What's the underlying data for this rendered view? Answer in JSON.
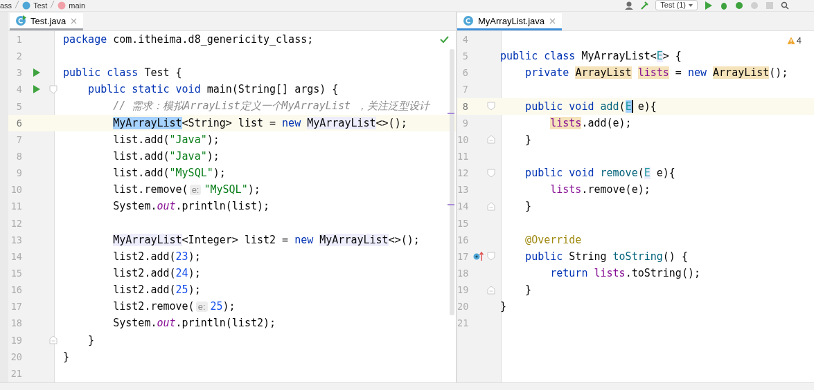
{
  "breadcrumbs": [
    {
      "label": "ass",
      "kind": "text"
    },
    {
      "label": "Test",
      "kind": "class"
    },
    {
      "label": "main",
      "kind": "method"
    }
  ],
  "toolbar": {
    "run_config": "Test (1)"
  },
  "panes": [
    {
      "active": false,
      "tab": {
        "label": "Test.java",
        "selected": true,
        "runnable": true
      },
      "no_problems": true,
      "lines": [
        {
          "n": "1",
          "tokens": [
            {
              "t": "package ",
              "kind": "kw"
            },
            {
              "t": "com.itheima.d8_genericity_class;",
              "kind": "plain"
            }
          ]
        },
        {
          "n": "2"
        },
        {
          "n": "3",
          "run": true,
          "tokens": [
            {
              "t": "public class ",
              "kind": "kw"
            },
            {
              "t": "Test {",
              "kind": "plain"
            }
          ]
        },
        {
          "n": "4",
          "run": true,
          "fold_start": true,
          "tokens": [
            {
              "t": "    public static void ",
              "kind": "kw"
            },
            {
              "t": "main(String[] args) {",
              "kind": "plain"
            }
          ]
        },
        {
          "n": "5",
          "tokens": [
            {
              "t": "        // 需求：模拟ArrayList定义一个MyArrayList ，关注泛型设计",
              "kind": "cmt"
            }
          ]
        },
        {
          "n": "6",
          "current": true,
          "tokens": [
            {
              "t": "        MyArrayList",
              "kind": "plain",
              "selected": true
            },
            {
              "t": "<String> list = ",
              "kind": "plain"
            },
            {
              "t": "new ",
              "kind": "kw"
            },
            {
              "t": "MyArrayList",
              "kind": "plain",
              "usage": true
            },
            {
              "t": "<>();",
              "kind": "plain"
            }
          ]
        },
        {
          "n": "7",
          "tokens": [
            {
              "t": "        list.add(",
              "kind": "plain"
            },
            {
              "t": "\"Java\"",
              "kind": "str"
            },
            {
              "t": ");",
              "kind": "plain"
            }
          ]
        },
        {
          "n": "8",
          "tokens": [
            {
              "t": "        list.add(",
              "kind": "plain"
            },
            {
              "t": "\"Java\"",
              "kind": "str"
            },
            {
              "t": ");",
              "kind": "plain"
            }
          ]
        },
        {
          "n": "9",
          "tokens": [
            {
              "t": "        list.add(",
              "kind": "plain"
            },
            {
              "t": "\"MySQL\"",
              "kind": "str"
            },
            {
              "t": ");",
              "kind": "plain"
            }
          ]
        },
        {
          "n": "10",
          "tokens": [
            {
              "t": "        list.remove(",
              "kind": "plain"
            },
            {
              "t": "e:",
              "kind": "hint"
            },
            {
              "t": "\"MySQL\"",
              "kind": "str"
            },
            {
              "t": ");",
              "kind": "plain"
            }
          ]
        },
        {
          "n": "11",
          "tokens": [
            {
              "t": "        System.",
              "kind": "plain"
            },
            {
              "t": "out",
              "kind": "static"
            },
            {
              "t": ".println(list);",
              "kind": "plain"
            }
          ]
        },
        {
          "n": "12"
        },
        {
          "n": "13",
          "tokens": [
            {
              "t": "        MyArrayList",
              "kind": "plain",
              "usage": true
            },
            {
              "t": "<Integer> list2 = ",
              "kind": "plain"
            },
            {
              "t": "new ",
              "kind": "kw"
            },
            {
              "t": "MyArrayList",
              "kind": "plain",
              "usage": true
            },
            {
              "t": "<>();",
              "kind": "plain"
            }
          ]
        },
        {
          "n": "14",
          "tokens": [
            {
              "t": "        list2.add(",
              "kind": "plain"
            },
            {
              "t": "23",
              "kind": "num"
            },
            {
              "t": ");",
              "kind": "plain"
            }
          ]
        },
        {
          "n": "15",
          "tokens": [
            {
              "t": "        list2.add(",
              "kind": "plain"
            },
            {
              "t": "24",
              "kind": "num"
            },
            {
              "t": ");",
              "kind": "plain"
            }
          ]
        },
        {
          "n": "16",
          "tokens": [
            {
              "t": "        list2.add(",
              "kind": "plain"
            },
            {
              "t": "25",
              "kind": "num"
            },
            {
              "t": ");",
              "kind": "plain"
            }
          ]
        },
        {
          "n": "17",
          "tokens": [
            {
              "t": "        list2.remove(",
              "kind": "plain"
            },
            {
              "t": "e:",
              "kind": "hint"
            },
            {
              "t": "25",
              "kind": "num"
            },
            {
              "t": ");",
              "kind": "plain"
            }
          ]
        },
        {
          "n": "18",
          "tokens": [
            {
              "t": "        System.",
              "kind": "plain"
            },
            {
              "t": "out",
              "kind": "static"
            },
            {
              "t": ".println(list2);",
              "kind": "plain"
            }
          ]
        },
        {
          "n": "19",
          "fold_end": true,
          "tokens": [
            {
              "t": "    }",
              "kind": "plain"
            }
          ]
        },
        {
          "n": "20",
          "tokens": [
            {
              "t": "}",
              "kind": "plain"
            }
          ]
        },
        {
          "n": "21"
        }
      ]
    },
    {
      "active": true,
      "tab": {
        "label": "MyArrayList.java",
        "selected": true,
        "runnable": false
      },
      "warnings": "4",
      "lines": [
        {
          "n": "4"
        },
        {
          "n": "5",
          "tokens": [
            {
              "t": "public class ",
              "kind": "kw"
            },
            {
              "t": "MyArrayList<",
              "kind": "plain"
            },
            {
              "t": "E",
              "kind": "tparam",
              "usage": true
            },
            {
              "t": "> {",
              "kind": "plain"
            }
          ]
        },
        {
          "n": "6",
          "tokens": [
            {
              "t": "    private ",
              "kind": "kw"
            },
            {
              "t": "ArrayList",
              "kind": "plain",
              "write": true
            },
            {
              "t": " lists",
              "kind": "field",
              "write": true
            },
            {
              "t": " = ",
              "kind": "plain"
            },
            {
              "t": "new ",
              "kind": "kw"
            },
            {
              "t": "ArrayList",
              "kind": "plain",
              "write": true
            },
            {
              "t": "();",
              "kind": "plain"
            }
          ]
        },
        {
          "n": "7"
        },
        {
          "n": "8",
          "current": true,
          "fold_start": true,
          "tokens": [
            {
              "t": "    public void ",
              "kind": "kw"
            },
            {
              "t": "add",
              "kind": "decl"
            },
            {
              "t": "(",
              "kind": "plain"
            },
            {
              "t": "E",
              "kind": "tparam",
              "selected": true,
              "caret": true
            },
            {
              "t": " e){",
              "kind": "plain"
            }
          ]
        },
        {
          "n": "9",
          "tokens": [
            {
              "t": "        lists",
              "kind": "field",
              "write": true
            },
            {
              "t": ".add(e);",
              "kind": "plain"
            }
          ]
        },
        {
          "n": "10",
          "fold_end": true,
          "tokens": [
            {
              "t": "    }",
              "kind": "plain"
            }
          ]
        },
        {
          "n": "11"
        },
        {
          "n": "12",
          "fold_start": true,
          "tokens": [
            {
              "t": "    public void ",
              "kind": "kw"
            },
            {
              "t": "remove",
              "kind": "decl"
            },
            {
              "t": "(",
              "kind": "plain"
            },
            {
              "t": "E",
              "kind": "tparam",
              "usage": true
            },
            {
              "t": " e){",
              "kind": "plain"
            }
          ]
        },
        {
          "n": "13",
          "tokens": [
            {
              "t": "        lists",
              "kind": "field"
            },
            {
              "t": ".remove(e);",
              "kind": "plain"
            }
          ]
        },
        {
          "n": "14",
          "fold_end": true,
          "tokens": [
            {
              "t": "    }",
              "kind": "plain"
            }
          ]
        },
        {
          "n": "15"
        },
        {
          "n": "16",
          "tokens": [
            {
              "t": "    @Override",
              "kind": "ann"
            }
          ]
        },
        {
          "n": "17",
          "override": true,
          "fold_start": true,
          "tokens": [
            {
              "t": "    public ",
              "kind": "kw"
            },
            {
              "t": "String ",
              "kind": "plain"
            },
            {
              "t": "toString",
              "kind": "decl"
            },
            {
              "t": "() {",
              "kind": "plain"
            }
          ]
        },
        {
          "n": "18",
          "tokens": [
            {
              "t": "        return ",
              "kind": "kw"
            },
            {
              "t": "lists",
              "kind": "field"
            },
            {
              "t": ".toString();",
              "kind": "plain"
            }
          ]
        },
        {
          "n": "19",
          "fold_end": true,
          "tokens": [
            {
              "t": "    }",
              "kind": "plain"
            }
          ]
        },
        {
          "n": "20",
          "tokens": [
            {
              "t": "}",
              "kind": "plain"
            }
          ]
        },
        {
          "n": "21"
        }
      ]
    }
  ]
}
